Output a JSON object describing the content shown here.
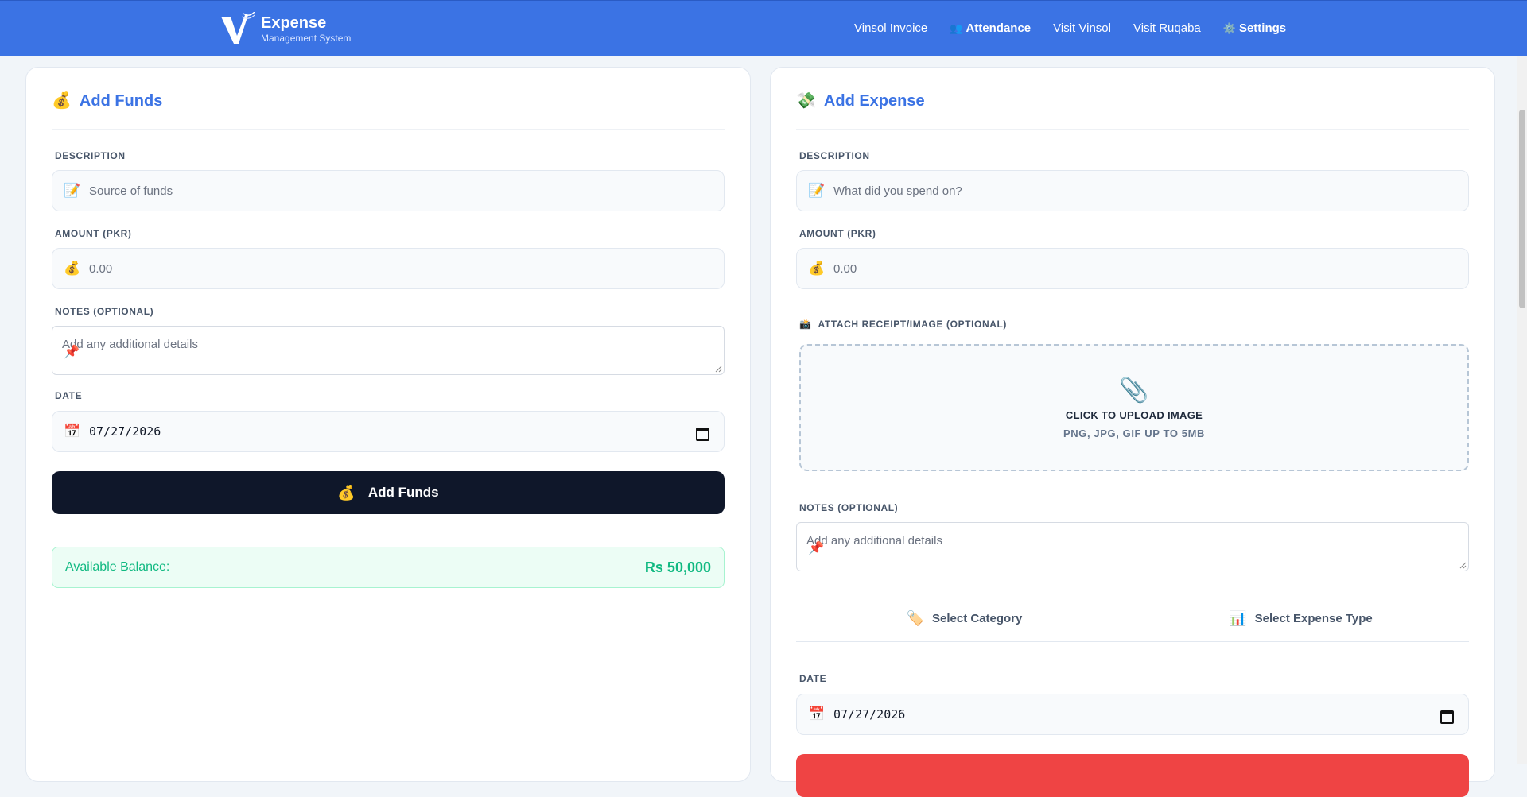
{
  "header": {
    "brand_title": "Expense",
    "brand_subtitle": "Management System",
    "nav": [
      {
        "label": "Vinsol Invoice",
        "icon": ""
      },
      {
        "label": "Attendance",
        "icon": "👥"
      },
      {
        "label": "Visit Vinsol",
        "icon": ""
      },
      {
        "label": "Visit Ruqaba",
        "icon": ""
      },
      {
        "label": "Settings",
        "icon": "⚙️"
      }
    ]
  },
  "funds": {
    "title": "Add Funds",
    "title_icon": "💰",
    "description_label": "DESCRIPTION",
    "description_icon": "📝",
    "description_placeholder": "Source of funds",
    "amount_label": "AMOUNT (PKR)",
    "amount_icon": "💰",
    "amount_placeholder": "0.00",
    "notes_label": "NOTES (OPTIONAL)",
    "notes_placeholder": "Add any additional details",
    "notes_icon": "📌",
    "date_label": "DATE",
    "date_icon": "📅",
    "date_value": "07/27/2026",
    "submit_icon": "💰",
    "submit_label": "Add Funds",
    "balance_label": "Available Balance:",
    "balance_value": "Rs 50,000"
  },
  "expense": {
    "title": "Add Expense",
    "title_icon": "💸",
    "description_label": "DESCRIPTION",
    "description_icon": "📝",
    "description_placeholder": "What did you spend on?",
    "amount_label": "AMOUNT (PKR)",
    "amount_icon": "💰",
    "amount_placeholder": "0.00",
    "attach_icon": "📸",
    "attach_label": "ATTACH RECEIPT/IMAGE (OPTIONAL)",
    "upload_icon": "📎",
    "upload_text": "CLICK TO UPLOAD IMAGE",
    "upload_hint": "PNG, JPG, GIF UP TO 5MB",
    "notes_label": "NOTES (OPTIONAL)",
    "notes_placeholder": "Add any additional details",
    "notes_icon": "📌",
    "category_icon": "🏷️",
    "category_label": "Select Category",
    "type_icon": "📊",
    "type_label": "Select Expense Type",
    "date_label": "DATE",
    "date_icon": "📅",
    "date_value": "07/27/2026"
  },
  "colors": {
    "primary": "#3b73e4",
    "dark_button": "#0f172a",
    "success": "#10b981",
    "danger": "#ef4444"
  }
}
